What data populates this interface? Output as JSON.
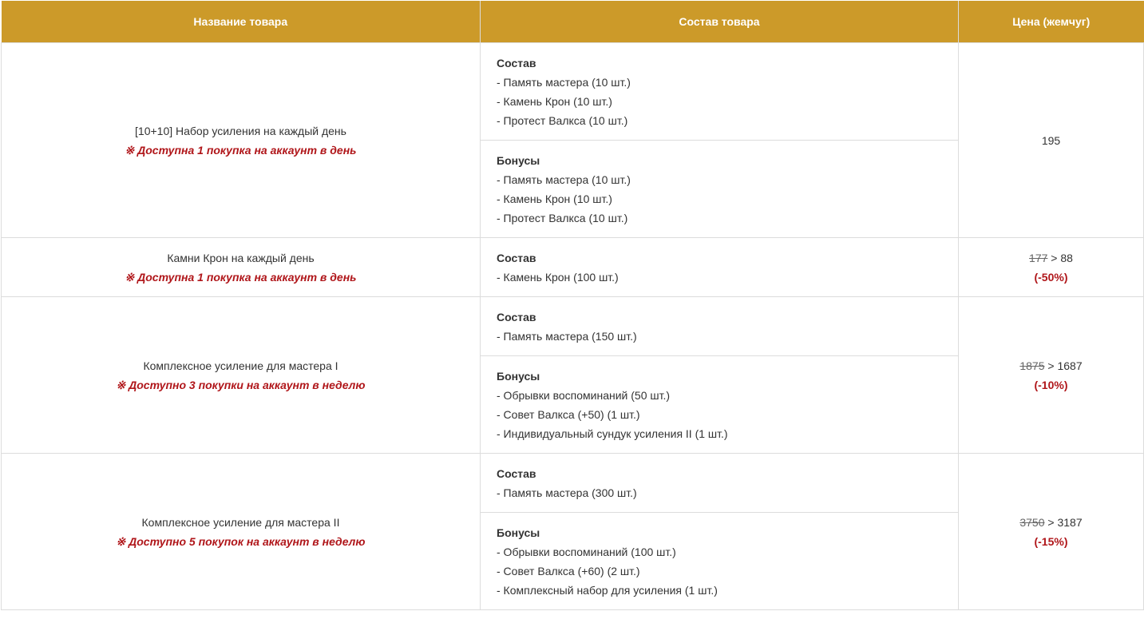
{
  "headers": {
    "name": "Название товара",
    "composition": "Состав товара",
    "price": "Цена (жемчуг)"
  },
  "rows": [
    {
      "name": "[10+10] Набор усиления на каждый день",
      "limit": "※ Доступна 1 покупка на аккаунт в день",
      "sections": [
        {
          "title": "Состав",
          "items": [
            "- Память мастера (10 шт.)",
            "- Камень Крон (10 шт.)",
            "- Протест Валкса (10 шт.)"
          ]
        },
        {
          "title": "Бонусы",
          "items": [
            "- Память мастера (10 шт.)",
            "- Камень Крон (10 шт.)",
            "- Протест Валкса (10 шт.)"
          ]
        }
      ],
      "price": {
        "old": "",
        "arrow": "",
        "new": "195",
        "discount": ""
      }
    },
    {
      "name": "Камни Крон на каждый день",
      "limit": "※ Доступна 1 покупка на аккаунт в день",
      "sections": [
        {
          "title": "Состав",
          "items": [
            "- Камень Крон (100 шт.)"
          ]
        }
      ],
      "price": {
        "old": "177",
        "arrow": " > ",
        "new": "88",
        "discount": "(-50%)"
      }
    },
    {
      "name": "Комплексное усиление для мастера I",
      "limit": "※ Доступно 3 покупки на аккаунт в неделю",
      "sections": [
        {
          "title": "Состав",
          "items": [
            "- Память мастера (150 шт.)"
          ]
        },
        {
          "title": "Бонусы",
          "items": [
            "- Обрывки воспоминаний (50 шт.)",
            "- Совет Валкса (+50) (1 шт.)",
            "- Индивидуальный сундук усиления II (1 шт.)"
          ]
        }
      ],
      "price": {
        "old": "1875",
        "arrow": " > ",
        "new": "1687",
        "discount": "(-10%)"
      }
    },
    {
      "name": "Комплексное усиление для мастера II",
      "limit": "※ Доступно 5 покупок на аккаунт в неделю",
      "sections": [
        {
          "title": "Состав",
          "items": [
            "- Память мастера (300 шт.)"
          ]
        },
        {
          "title": "Бонусы",
          "items": [
            "- Обрывки воспоминаний (100 шт.)",
            "- Совет Валкса (+60) (2 шт.)",
            "- Комплексный набор для усиления (1 шт.)"
          ]
        }
      ],
      "price": {
        "old": "3750",
        "arrow": " > ",
        "new": "3187",
        "discount": "(-15%)"
      }
    }
  ],
  "colors": {
    "header_bg": "#cc9a29",
    "header_text": "#ffffff",
    "accent_red": "#b0161a",
    "border": "#dcdcdc"
  }
}
